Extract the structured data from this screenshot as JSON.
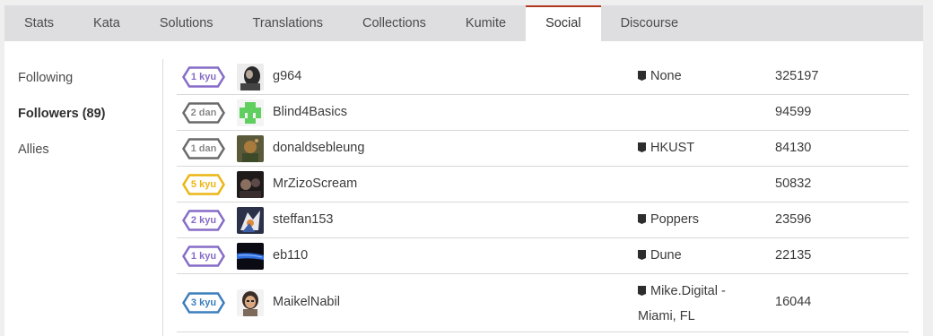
{
  "tabs": [
    {
      "label": "Stats"
    },
    {
      "label": "Kata"
    },
    {
      "label": "Solutions"
    },
    {
      "label": "Translations"
    },
    {
      "label": "Collections"
    },
    {
      "label": "Kumite"
    },
    {
      "label": "Social",
      "active": true
    },
    {
      "label": "Discourse"
    }
  ],
  "sidenav": {
    "following": "Following",
    "followers": "Followers (89)",
    "allies": "Allies"
  },
  "colors": {
    "tab_active_border": "#b1361e",
    "rank_purple": "#866cc7",
    "rank_white": "#6a6a6a",
    "rank_yellow": "#ecb613",
    "rank_blue": "#3c7ebb"
  },
  "rows": [
    {
      "rank": "1 kyu",
      "rank_color": "purple",
      "username": "g964",
      "clan": "None",
      "honor": "325197",
      "avatar_icon": "avatar-dark-icon"
    },
    {
      "rank": "2 dan",
      "rank_color": "white",
      "username": "Blind4Basics",
      "clan": "",
      "honor": "94599",
      "avatar_icon": "avatar-green-identicon"
    },
    {
      "rank": "1 dan",
      "rank_color": "white",
      "username": "donaldsebleung",
      "clan": "HKUST",
      "honor": "84130",
      "avatar_icon": "avatar-photo-icon"
    },
    {
      "rank": "5 kyu",
      "rank_color": "yellow",
      "username": "MrZizoScream",
      "clan": "",
      "honor": "50832",
      "avatar_icon": "avatar-photo-icon"
    },
    {
      "rank": "2 kyu",
      "rank_color": "purple",
      "username": "steffan153",
      "clan": "Poppers",
      "honor": "23596",
      "avatar_icon": "avatar-anime-icon"
    },
    {
      "rank": "1 kyu",
      "rank_color": "purple",
      "username": "eb110",
      "clan": "Dune",
      "honor": "22135",
      "avatar_icon": "avatar-blue-streak-icon"
    },
    {
      "rank": "3 kyu",
      "rank_color": "blue",
      "username": "MaikelNabil",
      "clan": "Mike.Digital - Miami, FL",
      "honor": "16044",
      "avatar_icon": "avatar-cartoon-icon"
    }
  ]
}
